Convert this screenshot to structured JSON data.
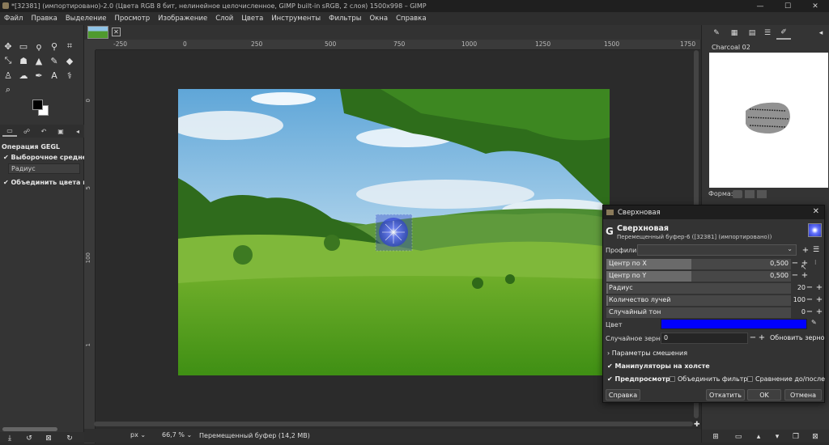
{
  "window": {
    "title": "*[32381] (импортировано)-2.0 (Цвета RGB 8 бит, нелинейное целочисленное, GIMP built-in sRGB, 2 слоя) 1500x998 – GIMP",
    "minimize": "—",
    "maximize": "☐",
    "close": "✕"
  },
  "menu": [
    "Файл",
    "Правка",
    "Выделение",
    "Просмотр",
    "Изображение",
    "Слой",
    "Цвета",
    "Инструменты",
    "Фильтры",
    "Окна",
    "Справка"
  ],
  "tool_options": {
    "title": "Операция GEGL",
    "option1": "Выборочное среднее",
    "radius_placeholder": "Радиус",
    "option2": "Объединить цвета все"
  },
  "rulers": {
    "top": [
      "-250",
      "0",
      "250",
      "500",
      "750",
      "1000",
      "1250",
      "1500",
      "1750"
    ],
    "left": [
      "0",
      "5",
      "100",
      "1"
    ]
  },
  "status": {
    "unit": "px",
    "zoom": "66,7 %",
    "message": "Перемещенный буфер (14,2 MB)"
  },
  "brushes": {
    "name": "Charcoal 02",
    "shape_label": "Форма:"
  },
  "dialog": {
    "window_title": "Сверхновая",
    "heading": "Сверхновая",
    "subheading": "Перемещенный буфер-6 ([32381] (импортировано))",
    "profiles_label": "Профили:",
    "fields": [
      {
        "label": "Центр по X",
        "value": "0,500",
        "fill": 0.46
      },
      {
        "label": "Центр по Y",
        "value": "0,500",
        "fill": 0.46
      },
      {
        "label": "Радиус",
        "value": "20",
        "fill": 0.01
      },
      {
        "label": "Количество лучей",
        "value": "100",
        "fill": 0.01
      },
      {
        "label": "Случайный тон",
        "value": "0",
        "fill": 0.0
      }
    ],
    "color_label": "Цвет",
    "color_value": "#0000ff",
    "seed_label": "Случайное зерно",
    "seed_value": "0",
    "seed_button": "Обновить зерно",
    "blend_params": "Параметры смешения",
    "canvas_handles": "Манипуляторы на холсте",
    "preview": "Предпросмотр",
    "merge_filter": "Объединить фильтр",
    "compare": "Сравнение до/после",
    "help": "Справка",
    "reset": "Откатить",
    "ok": "OK",
    "cancel": "Отмена"
  }
}
